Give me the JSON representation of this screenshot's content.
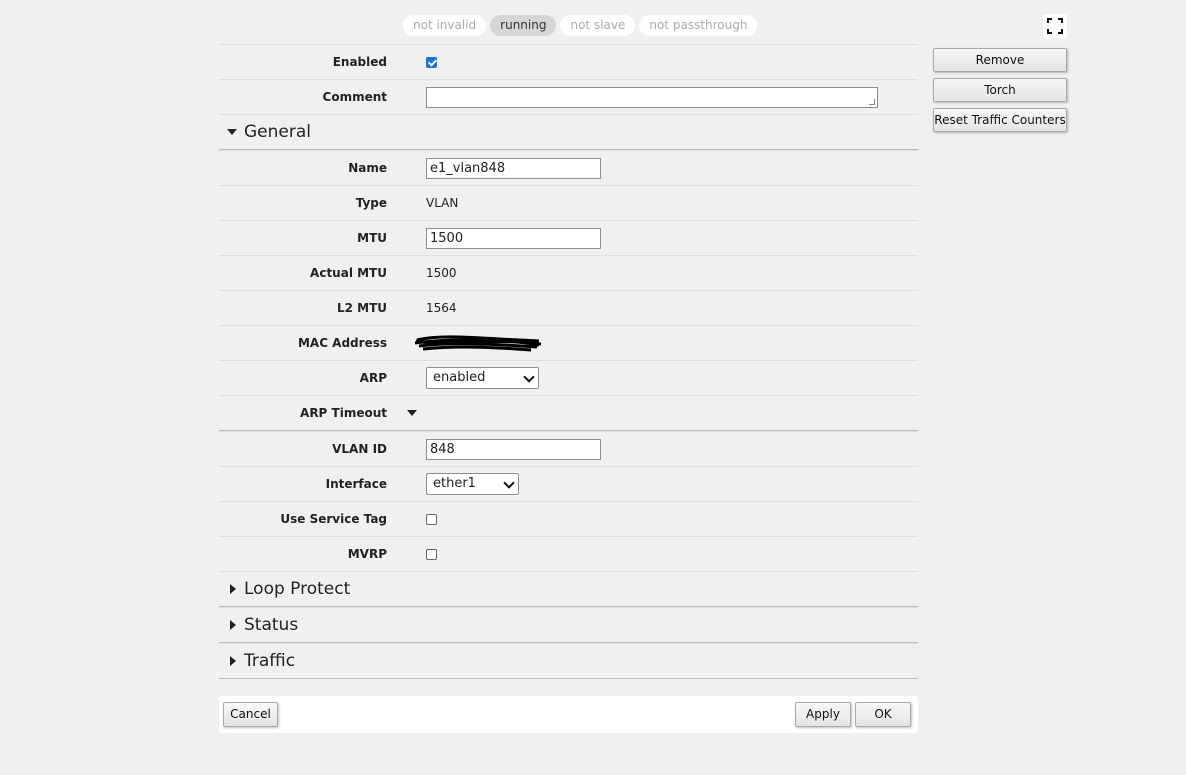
{
  "status_pills": [
    {
      "label": "not invalid",
      "active": false
    },
    {
      "label": "running",
      "active": true
    },
    {
      "label": "not slave",
      "active": false
    },
    {
      "label": "not passthrough",
      "active": false
    }
  ],
  "side_buttons": {
    "remove": "Remove",
    "torch": "Torch",
    "reset": "Reset Traffic Counters"
  },
  "top_fields": {
    "enabled_label": "Enabled",
    "enabled_checked": true,
    "comment_label": "Comment",
    "comment_value": ""
  },
  "general": {
    "title": "General",
    "name_label": "Name",
    "name_value": "e1_vlan848",
    "type_label": "Type",
    "type_value": "VLAN",
    "mtu_label": "MTU",
    "mtu_value": "1500",
    "actual_mtu_label": "Actual MTU",
    "actual_mtu_value": "1500",
    "l2mtu_label": "L2 MTU",
    "l2mtu_value": "1564",
    "mac_label": "MAC Address",
    "arp_label": "ARP",
    "arp_value": "enabled",
    "arp_timeout_label": "ARP Timeout",
    "vlan_id_label": "VLAN ID",
    "vlan_id_value": "848",
    "interface_label": "Interface",
    "interface_value": "ether1",
    "service_tag_label": "Use Service Tag",
    "service_tag_checked": false,
    "mvrp_label": "MVRP",
    "mvrp_checked": false
  },
  "sections": {
    "loop_protect": "Loop Protect",
    "status": "Status",
    "traffic": "Traffic"
  },
  "footer": {
    "cancel": "Cancel",
    "apply": "Apply",
    "ok": "OK"
  },
  "icons": {
    "fullscreen": "fullscreen-icon"
  }
}
